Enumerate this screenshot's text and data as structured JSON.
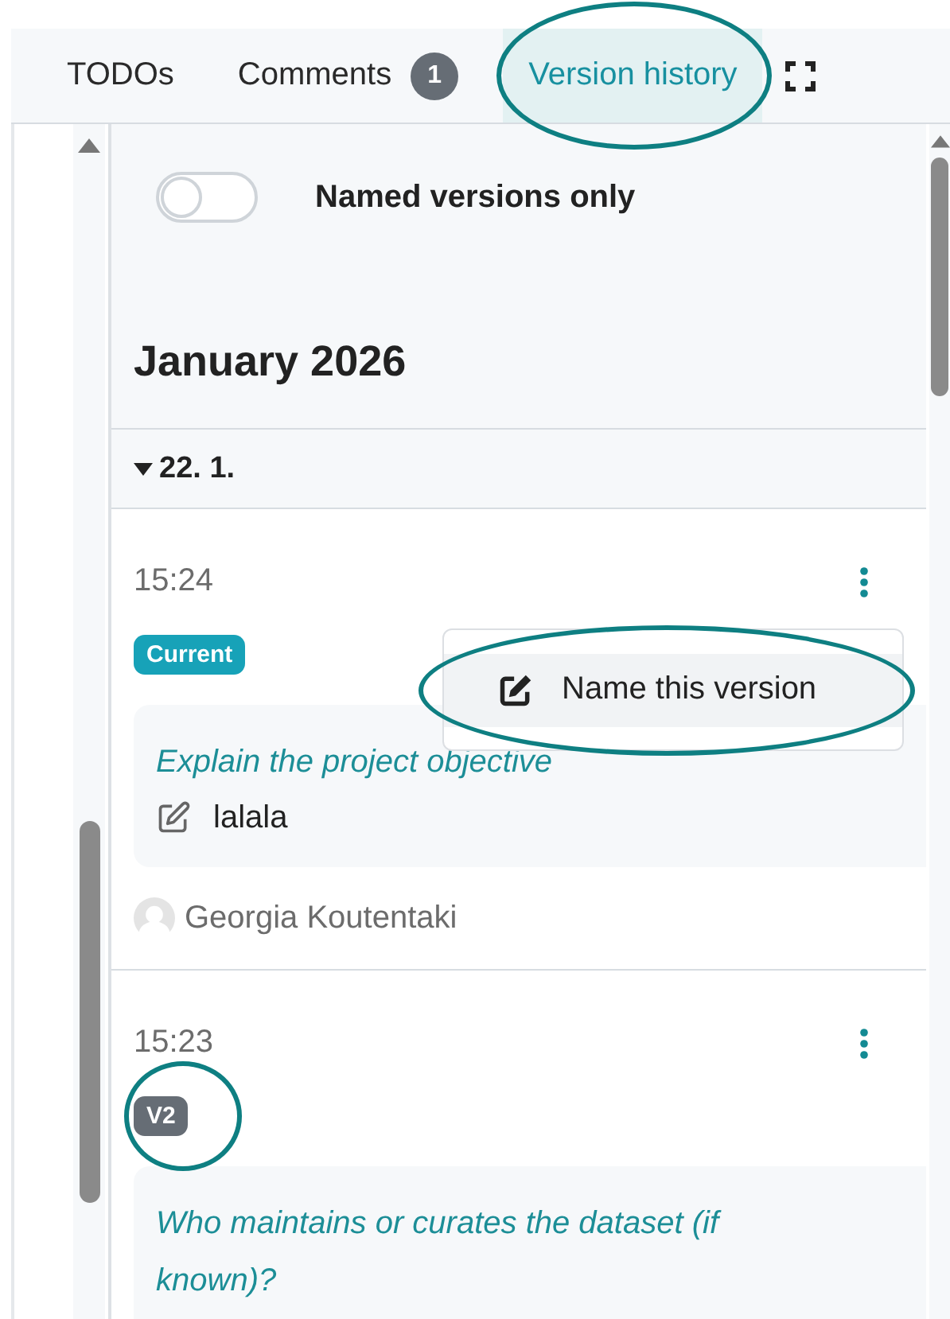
{
  "tabs": [
    {
      "label": "TODOs",
      "selected": false,
      "highlighted": false
    },
    {
      "label": "Comments",
      "badge": "1",
      "selected": false,
      "highlighted": false
    },
    {
      "label": "Version history",
      "selected": true,
      "highlighted": true
    }
  ],
  "filter": {
    "label": "Named versions only",
    "on": false
  },
  "month": "January 2026",
  "day_group": {
    "label": "22. 1.",
    "expanded": true
  },
  "versions": [
    {
      "time": "15:24",
      "tag": "Current",
      "color": "#17a2b8",
      "question": "Explain the project objective",
      "answer": "lalala",
      "author": "Georgia Koutentaki",
      "menu": [
        {
          "label": "Name this version",
          "highlighted": true
        }
      ]
    },
    {
      "time": "15:23",
      "tag": "V2",
      "color": "#666d75",
      "tag_highlighted": true,
      "question": "Who maintains or curates the dataset (if known)?"
    }
  ]
}
